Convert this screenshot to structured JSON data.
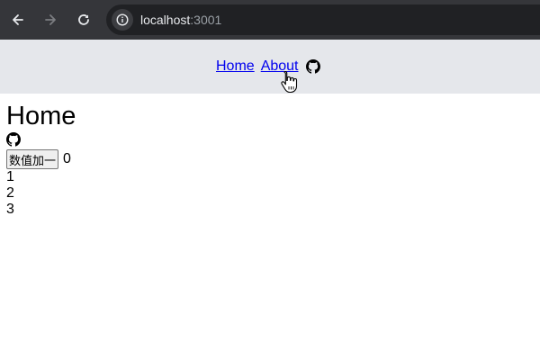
{
  "browser": {
    "url_host": "localhost",
    "url_port": ":3001",
    "back_icon": "arrow-left-icon",
    "forward_icon": "arrow-right-icon",
    "reload_icon": "reload-icon",
    "site_info_icon": "info-icon"
  },
  "nav": {
    "home_label": "Home",
    "about_label": "About",
    "github_icon": "github-icon"
  },
  "page": {
    "title": "Home",
    "github_icon": "github-icon",
    "button_label": "数值加一",
    "counter_value": "0",
    "list_items": [
      "1",
      "2",
      "3"
    ]
  },
  "colors": {
    "browser_bar": "#35363a",
    "omnibox": "#202124",
    "header_bg": "#e5e7eb",
    "link": "#0000ee"
  }
}
